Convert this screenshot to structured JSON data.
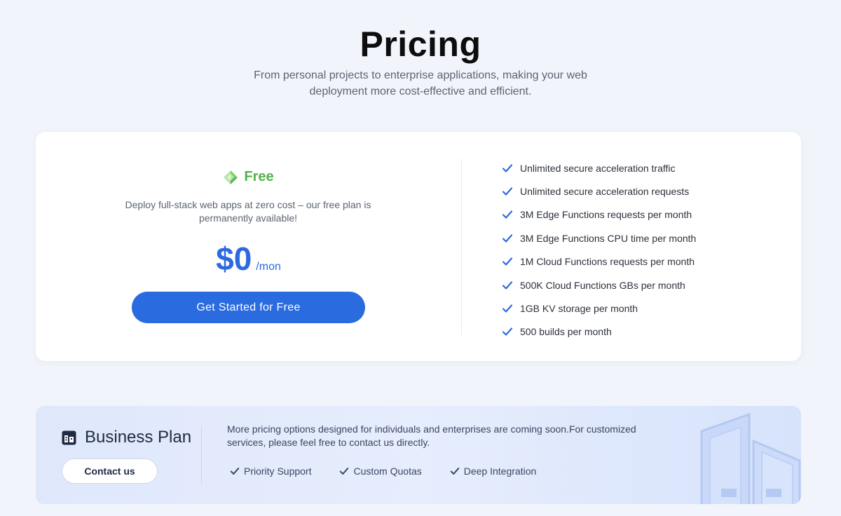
{
  "header": {
    "title": "Pricing",
    "subtitle": "From personal projects to enterprise applications, making your web deployment more cost-effective and efficient."
  },
  "free_plan": {
    "name": "Free",
    "icon": "diamond-icon",
    "description": "Deploy full-stack web apps at zero cost – our free plan is permanently available!",
    "price": "$0",
    "price_unit": "/mon",
    "cta_label": "Get Started for Free",
    "features": [
      "Unlimited secure acceleration traffic",
      "Unlimited secure acceleration requests",
      "3M Edge Functions requests per month",
      "3M Edge Functions CPU time per month",
      "1M Cloud Functions requests per month",
      "500K Cloud Functions GBs per month",
      "1GB KV storage per month",
      "500 builds per month"
    ]
  },
  "business_plan": {
    "title": "Business Plan",
    "icon": "building-icon",
    "contact_label": "Contact us",
    "description": "More pricing options designed for individuals and enterprises are coming soon.For customized services, please feel free to contact us directly.",
    "features": [
      "Priority Support",
      "Custom Quotas",
      "Deep Integration"
    ]
  },
  "colors": {
    "accent": "#2a6bdf",
    "free_green": "#52b44b",
    "check": "#2d6ae0",
    "background": "#f1f4fa"
  }
}
